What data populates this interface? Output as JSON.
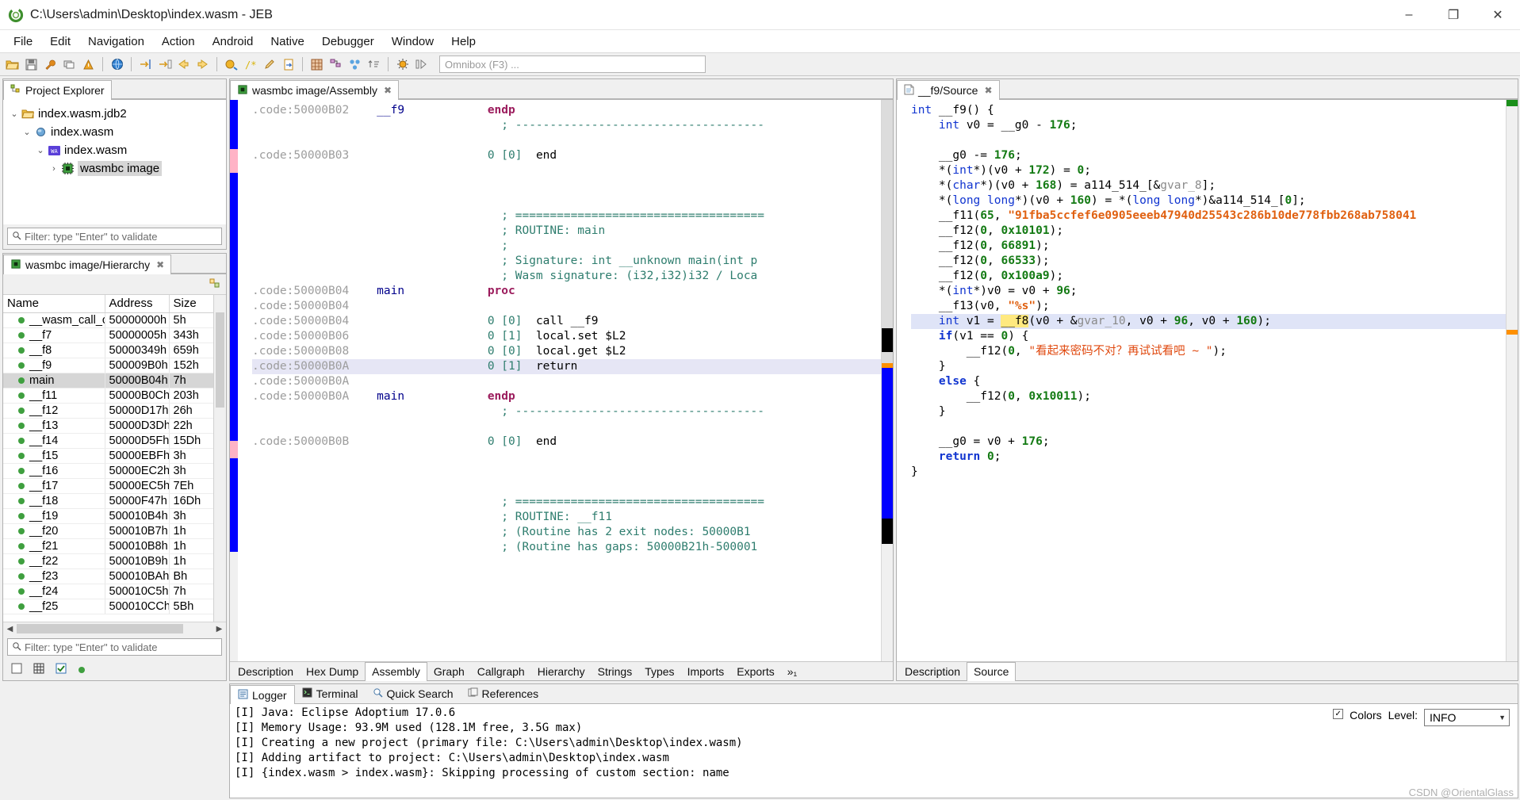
{
  "window": {
    "title": "C:\\Users\\admin\\Desktop\\index.wasm - JEB",
    "app_icon": "jeb-logo-icon",
    "minimize": "–",
    "maximize": "❐",
    "close": "✕"
  },
  "menubar": [
    "File",
    "Edit",
    "Navigation",
    "Action",
    "Android",
    "Native",
    "Debugger",
    "Window",
    "Help"
  ],
  "toolbar": {
    "omnibox_placeholder": "Omnibox (F3) ...",
    "buttons": [
      "open-folder-icon",
      "save-icon",
      "wrench-icon",
      "window-icon",
      "warning-icon",
      "|",
      "globe-icon",
      "|",
      "goto-icon",
      "goto-end-icon",
      "back-arrow-icon",
      "forward-arrow-icon",
      "|",
      "refactor-icon",
      "comment-icon",
      "rename-icon",
      "export-icon",
      "|",
      "table-icon",
      "graph-icon",
      "nodes-icon",
      "sort-icon",
      "|",
      "debug-icon",
      "step-icon"
    ]
  },
  "project_explorer": {
    "tab_title": "Project Explorer",
    "tab_icon": "project-icon",
    "tree": [
      {
        "label": "index.wasm.jdb2",
        "icon": "folder-icon",
        "depth": 0,
        "arrow": "⌄",
        "selected": false
      },
      {
        "label": "index.wasm",
        "icon": "sphere-icon",
        "depth": 1,
        "arrow": "⌄",
        "selected": false
      },
      {
        "label": "index.wasm",
        "icon": "wa-icon",
        "depth": 2,
        "arrow": "⌄",
        "selected": false
      },
      {
        "label": "wasmbc image",
        "icon": "chip-icon",
        "depth": 3,
        "arrow": "›",
        "selected": true
      }
    ],
    "filter_placeholder": "Filter: type \"Enter\" to validate"
  },
  "hierarchy": {
    "tab_title": "wasmbc image/Hierarchy",
    "tab_icon": "chip-icon",
    "columns": [
      "Name",
      "Address",
      "Size"
    ],
    "rows": [
      {
        "name": "__wasm_call_c",
        "address": "50000000h",
        "size": "5h",
        "selected": false
      },
      {
        "name": "__f7",
        "address": "50000005h",
        "size": "343h",
        "selected": false
      },
      {
        "name": "__f8",
        "address": "50000349h",
        "size": "659h",
        "selected": false
      },
      {
        "name": "__f9",
        "address": "500009B0h",
        "size": "152h",
        "selected": false
      },
      {
        "name": "main",
        "address": "50000B04h",
        "size": "7h",
        "selected": true
      },
      {
        "name": "__f11",
        "address": "50000B0Ch",
        "size": "203h",
        "selected": false
      },
      {
        "name": "__f12",
        "address": "50000D17h",
        "size": "26h",
        "selected": false
      },
      {
        "name": "__f13",
        "address": "50000D3Dh",
        "size": "22h",
        "selected": false
      },
      {
        "name": "__f14",
        "address": "50000D5Fh",
        "size": "15Dh",
        "selected": false
      },
      {
        "name": "__f15",
        "address": "50000EBFh",
        "size": "3h",
        "selected": false
      },
      {
        "name": "__f16",
        "address": "50000EC2h",
        "size": "3h",
        "selected": false
      },
      {
        "name": "__f17",
        "address": "50000EC5h",
        "size": "7Eh",
        "selected": false
      },
      {
        "name": "__f18",
        "address": "50000F47h",
        "size": "16Dh",
        "selected": false
      },
      {
        "name": "__f19",
        "address": "500010B4h",
        "size": "3h",
        "selected": false
      },
      {
        "name": "__f20",
        "address": "500010B7h",
        "size": "1h",
        "selected": false
      },
      {
        "name": "__f21",
        "address": "500010B8h",
        "size": "1h",
        "selected": false
      },
      {
        "name": "__f22",
        "address": "500010B9h",
        "size": "1h",
        "selected": false
      },
      {
        "name": "__f23",
        "address": "500010BAh",
        "size": "Bh",
        "selected": false
      },
      {
        "name": "__f24",
        "address": "500010C5h",
        "size": "7h",
        "selected": false
      },
      {
        "name": "__f25",
        "address": "500010CCh",
        "size": "5Bh",
        "selected": false
      }
    ],
    "filter_placeholder": "Filter: type \"Enter\" to validate"
  },
  "assembly": {
    "tab_title": "wasmbc image/Assembly",
    "tab_icon": "chip-icon",
    "view_tabs": [
      "Description",
      "Hex Dump",
      "Assembly",
      "Graph",
      "Callgraph",
      "Hierarchy",
      "Strings",
      "Types",
      "Imports",
      "Exports"
    ],
    "view_tabs_overflow": "»₁",
    "active_view_tab": "Assembly",
    "lines": [
      {
        "addr": ".code:50000B02",
        "label": "__f9",
        "stack": "",
        "text": "endp",
        "kind": "proc"
      },
      {
        "addr": "",
        "label": "",
        "stack": "",
        "text": "; ---------------------------------",
        "kind": "cmt"
      },
      {
        "addr": "",
        "label": "",
        "stack": "",
        "text": "",
        "kind": "blank"
      },
      {
        "addr": ".code:50000B03",
        "label": "",
        "stack": "0 [0]",
        "text": "end",
        "kind": "mn"
      },
      {
        "addr": "",
        "label": "",
        "stack": "",
        "text": "",
        "kind": "blank"
      },
      {
        "addr": "",
        "label": "",
        "stack": "",
        "text": "",
        "kind": "blank"
      },
      {
        "addr": "",
        "label": "",
        "stack": "",
        "text": "; =================================",
        "kind": "cmt"
      },
      {
        "addr": "",
        "label": "",
        "stack": "",
        "text": "; ROUTINE: main",
        "kind": "cmt"
      },
      {
        "addr": "",
        "label": "",
        "stack": "",
        "text": ";",
        "kind": "cmt"
      },
      {
        "addr": "",
        "label": "",
        "stack": "",
        "text": "; Signature: int __unknown main(int p",
        "kind": "cmt"
      },
      {
        "addr": "",
        "label": "",
        "stack": "",
        "text": "; Wasm signature: (i32,i32)i32 / Loca",
        "kind": "cmt"
      },
      {
        "addr": ".code:50000B04",
        "label": "main",
        "stack": "",
        "text": "proc",
        "kind": "proc"
      },
      {
        "addr": ".code:50000B04",
        "label": "",
        "stack": "",
        "text": "",
        "kind": "blank"
      },
      {
        "addr": ".code:50000B04",
        "label": "",
        "stack": "0 [0]",
        "text": "call __f9",
        "kind": "mn"
      },
      {
        "addr": ".code:50000B06",
        "label": "",
        "stack": "0 [1]",
        "text": "local.set $L2",
        "kind": "mn"
      },
      {
        "addr": ".code:50000B08",
        "label": "",
        "stack": "0 [0]",
        "text": "local.get $L2",
        "kind": "mn"
      },
      {
        "addr": ".code:50000B0A",
        "label": "",
        "stack": "0 [1]",
        "text": "return",
        "kind": "mn",
        "highlight": true
      },
      {
        "addr": ".code:50000B0A",
        "label": "",
        "stack": "",
        "text": "",
        "kind": "blank"
      },
      {
        "addr": ".code:50000B0A",
        "label": "main",
        "stack": "",
        "text": "endp",
        "kind": "proc"
      },
      {
        "addr": "",
        "label": "",
        "stack": "",
        "text": "; ---------------------------------",
        "kind": "cmt"
      },
      {
        "addr": "",
        "label": "",
        "stack": "",
        "text": "",
        "kind": "blank"
      },
      {
        "addr": ".code:50000B0B",
        "label": "",
        "stack": "0 [0]",
        "text": "end",
        "kind": "mn"
      },
      {
        "addr": "",
        "label": "",
        "stack": "",
        "text": "",
        "kind": "blank"
      },
      {
        "addr": "",
        "label": "",
        "stack": "",
        "text": "",
        "kind": "blank"
      },
      {
        "addr": "",
        "label": "",
        "stack": "",
        "text": "; =================================",
        "kind": "cmt"
      },
      {
        "addr": "",
        "label": "",
        "stack": "",
        "text": "; ROUTINE: __f11",
        "kind": "cmt"
      },
      {
        "addr": "",
        "label": "",
        "stack": "",
        "text": "; (Routine has 2 exit nodes: 50000B1",
        "kind": "cmt"
      },
      {
        "addr": "",
        "label": "",
        "stack": "",
        "text": "; (Routine has gaps: 50000B21h-500001",
        "kind": "cmt"
      }
    ]
  },
  "source": {
    "tab_title": "__f9/Source",
    "tab_icon": "document-icon",
    "view_tabs": [
      "Description",
      "Source"
    ],
    "active_view_tab": "Source",
    "code_lines": [
      "int __f9() {",
      "    int v0 = __g0 - 176;",
      "",
      "    __g0 -= 176;",
      "    *(int*)(v0 + 172) = 0;",
      "    *(char*)(v0 + 168) = a114_514_[&gvar_8];",
      "    *(long long*)(v0 + 160) = *(long long*)&a114_514_[0];",
      "    __f11(65, \"91fba5ccfef6e0905eeeb47940d25543c286b10de778fbb268ab758041",
      "    __f12(0, 0x10101);",
      "    __f12(0, 66891);",
      "    __f12(0, 66533);",
      "    __f12(0, 0x100a9);",
      "    *(int*)v0 = v0 + 96;",
      "    __f13(v0, \"%s\");",
      "    int v1 = __f8(v0 + &gvar_10, v0 + 96, v0 + 160);",
      "    if(v1 == 0) {",
      "        __f12(0, \"看起来密码不对？再试试看吧 ~ \");",
      "    }",
      "    else {",
      "        __f12(0, 0x10011);",
      "    }",
      "",
      "    __g0 = v0 + 176;",
      "    return 0;",
      "}"
    ],
    "highlighted_line_index": 14,
    "highlighted_symbol": "__f8"
  },
  "dock": {
    "tabs": [
      {
        "label": "Logger",
        "icon": "logger-icon",
        "active": true
      },
      {
        "label": "Terminal",
        "icon": "terminal-icon",
        "active": false
      },
      {
        "label": "Quick Search",
        "icon": "search-icon",
        "active": false
      },
      {
        "label": "References",
        "icon": "references-icon",
        "active": false
      }
    ],
    "log_lines": [
      "[I] Java: Eclipse Adoptium 17.0.6",
      "[I] Memory Usage: 93.9M used (128.1M free, 3.5G max)",
      "[I] Creating a new project (primary file: C:\\Users\\admin\\Desktop\\index.wasm)",
      "[I] Adding artifact to project: C:\\Users\\admin\\Desktop\\index.wasm",
      "[I] {index.wasm > index.wasm}: Skipping processing of custom section: name"
    ],
    "colors_label": "Colors",
    "colors_checked": true,
    "level_label": "Level:",
    "level_value": "INFO"
  },
  "watermark": "CSDN @OrientalGlass"
}
